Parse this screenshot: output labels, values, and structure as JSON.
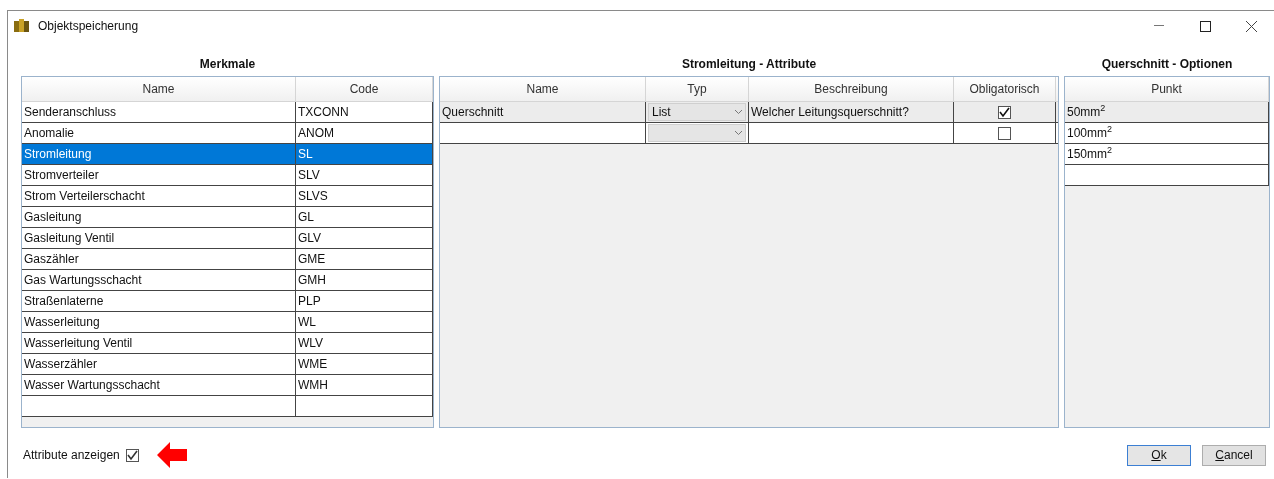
{
  "window": {
    "title": "Objektspeicherung"
  },
  "features": {
    "heading": "Merkmale",
    "columns": [
      "Name",
      "Code"
    ],
    "rows": [
      {
        "name": "Senderanschluss",
        "code": "TXCONN",
        "selected": false
      },
      {
        "name": "Anomalie",
        "code": "ANOM",
        "selected": false
      },
      {
        "name": "Stromleitung",
        "code": "SL",
        "selected": true
      },
      {
        "name": "Stromverteiler",
        "code": "SLV",
        "selected": false
      },
      {
        "name": "Strom Verteilerschacht",
        "code": "SLVS",
        "selected": false
      },
      {
        "name": "Gasleitung",
        "code": "GL",
        "selected": false
      },
      {
        "name": "Gasleitung Ventil",
        "code": "GLV",
        "selected": false
      },
      {
        "name": "Gaszähler",
        "code": "GME",
        "selected": false
      },
      {
        "name": "Gas Wartungsschacht",
        "code": "GMH",
        "selected": false
      },
      {
        "name": "Straßenlaterne",
        "code": "PLP",
        "selected": false
      },
      {
        "name": "Wasserleitung",
        "code": "WL",
        "selected": false
      },
      {
        "name": "Wasserleitung Ventil",
        "code": "WLV",
        "selected": false
      },
      {
        "name": "Wasserzähler",
        "code": "WME",
        "selected": false
      },
      {
        "name": "Wasser Wartungsschacht",
        "code": "WMH",
        "selected": false
      }
    ]
  },
  "attributes": {
    "heading": "Stromleitung - Attribute",
    "columns": [
      "Name",
      "Typ",
      "Beschreibung",
      "Obligatorisch"
    ],
    "rows": [
      {
        "name": "Querschnitt",
        "type": "List",
        "description": "Welcher Leitungsquerschnitt?",
        "mandatory": true,
        "selected": true
      },
      {
        "mandatory": false,
        "selected": false
      }
    ]
  },
  "options": {
    "heading": "Querschnitt - Optionen",
    "columns": [
      "Punkt"
    ],
    "rows": [
      {
        "value": "50mm$^{2}$",
        "selected": true
      },
      {
        "value": "100mm$^{2}$",
        "selected": false
      },
      {
        "value": "150mm$^{2}$",
        "selected": false
      }
    ]
  },
  "show_attributes": {
    "label": "Attribute anzeigen",
    "checked": true
  },
  "buttons": [
    "Ok",
    "Cancel"
  ]
}
